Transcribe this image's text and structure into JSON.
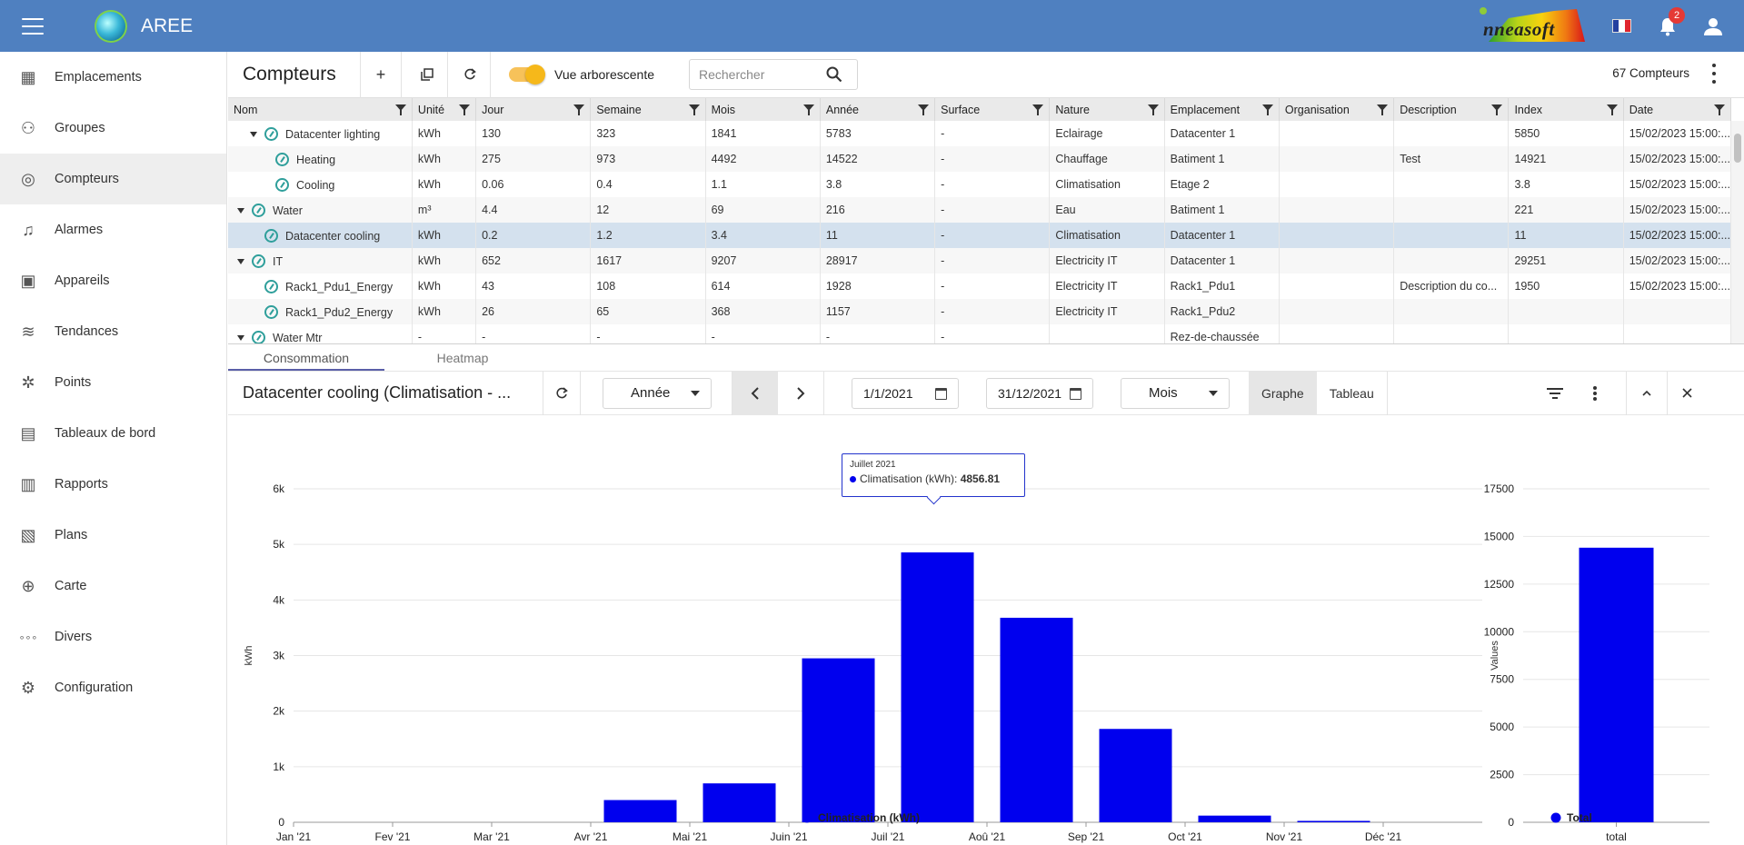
{
  "app": {
    "title": "AREE",
    "brand": "nneasoft",
    "notifications": "2"
  },
  "sidebar": {
    "items": [
      {
        "label": "Emplacements",
        "icon": "building-icon"
      },
      {
        "label": "Groupes",
        "icon": "groups-icon"
      },
      {
        "label": "Compteurs",
        "icon": "meter-icon",
        "active": true
      },
      {
        "label": "Alarmes",
        "icon": "alarm-icon"
      },
      {
        "label": "Appareils",
        "icon": "devices-icon"
      },
      {
        "label": "Tendances",
        "icon": "trends-icon"
      },
      {
        "label": "Points",
        "icon": "points-icon"
      },
      {
        "label": "Tableaux de bord",
        "icon": "dashboard-icon"
      },
      {
        "label": "Rapports",
        "icon": "reports-icon"
      },
      {
        "label": "Plans",
        "icon": "plans-icon"
      },
      {
        "label": "Carte",
        "icon": "map-icon"
      },
      {
        "label": "Divers",
        "icon": "misc-icon"
      },
      {
        "label": "Configuration",
        "icon": "config-icon"
      }
    ]
  },
  "toolbar": {
    "title": "Compteurs",
    "add": "+",
    "toggle_label": "Vue arborescente",
    "search_placeholder": "Rechercher",
    "count": "67 Compteurs"
  },
  "table": {
    "columns": [
      "Nom",
      "Unité",
      "Jour",
      "Semaine",
      "Mois",
      "Année",
      "Surface",
      "Nature",
      "Emplacement",
      "Organisation",
      "Description",
      "Index",
      "Date"
    ],
    "rows": [
      {
        "name": "Datacenter lighting",
        "level": 1,
        "expand": true,
        "unit": "kWh",
        "jour": "130",
        "semaine": "323",
        "mois": "1841",
        "annee": "5783",
        "surface": "-",
        "nature": "Eclairage",
        "emplacement": "Datacenter 1",
        "organisation": "",
        "description": "",
        "index": "5850",
        "date": "15/02/2023 15:00:..."
      },
      {
        "name": "Heating",
        "level": 2,
        "expand": false,
        "unit": "kWh",
        "jour": "275",
        "semaine": "973",
        "mois": "4492",
        "annee": "14522",
        "surface": "-",
        "nature": "Chauffage",
        "emplacement": "Batiment 1",
        "organisation": "",
        "description": "Test",
        "index": "14921",
        "date": "15/02/2023 15:00:..."
      },
      {
        "name": "Cooling",
        "level": 2,
        "expand": false,
        "unit": "kWh",
        "jour": "0.06",
        "semaine": "0.4",
        "mois": "1.1",
        "annee": "3.8",
        "surface": "-",
        "nature": "Climatisation",
        "emplacement": "Etage 2",
        "organisation": "",
        "description": "",
        "index": "3.8",
        "date": "15/02/2023 15:00:..."
      },
      {
        "name": "Water",
        "level": 0,
        "expand": true,
        "unit": "m³",
        "jour": "4.4",
        "semaine": "12",
        "mois": "69",
        "annee": "216",
        "surface": "-",
        "nature": "Eau",
        "emplacement": "Batiment 1",
        "organisation": "",
        "description": "",
        "index": "221",
        "date": "15/02/2023 15:00:..."
      },
      {
        "name": "Datacenter cooling",
        "level": 1,
        "expand": false,
        "selected": true,
        "unit": "kWh",
        "jour": "0.2",
        "semaine": "1.2",
        "mois": "3.4",
        "annee": "11",
        "surface": "-",
        "nature": "Climatisation",
        "emplacement": "Datacenter 1",
        "organisation": "",
        "description": "",
        "index": "11",
        "date": "15/02/2023 15:00:..."
      },
      {
        "name": "IT",
        "level": 0,
        "expand": true,
        "unit": "kWh",
        "jour": "652",
        "semaine": "1617",
        "mois": "9207",
        "annee": "28917",
        "surface": "-",
        "nature": "Electricity IT",
        "emplacement": "Datacenter 1",
        "organisation": "",
        "description": "",
        "index": "29251",
        "date": "15/02/2023 15:00:..."
      },
      {
        "name": "Rack1_Pdu1_Energy",
        "level": 1,
        "expand": false,
        "unit": "kWh",
        "jour": "43",
        "semaine": "108",
        "mois": "614",
        "annee": "1928",
        "surface": "-",
        "nature": "Electricity IT",
        "emplacement": "Rack1_Pdu1",
        "organisation": "",
        "description": "Description du co...",
        "index": "1950",
        "date": "15/02/2023 15:00:..."
      },
      {
        "name": "Rack1_Pdu2_Energy",
        "level": 1,
        "expand": false,
        "unit": "kWh",
        "jour": "26",
        "semaine": "65",
        "mois": "368",
        "annee": "1157",
        "surface": "-",
        "nature": "Electricity IT",
        "emplacement": "Rack1_Pdu2",
        "organisation": "",
        "description": "",
        "index": "",
        "date": ""
      },
      {
        "name": "Water Mtr",
        "level": 0,
        "expand": true,
        "unit": "-",
        "jour": "-",
        "semaine": "-",
        "mois": "-",
        "annee": "-",
        "surface": "-",
        "nature": "",
        "emplacement": "Rez-de-chaussée",
        "organisation": "",
        "description": "",
        "index": "",
        "date": ""
      }
    ]
  },
  "tabs": [
    "Consommation",
    "Heatmap"
  ],
  "chartbar": {
    "title": "Datacenter cooling (Climatisation - ...",
    "period": "Année",
    "start": "1/1/2021",
    "end": "31/12/2021",
    "granularity": "Mois",
    "view_graph": "Graphe",
    "view_table": "Tableau"
  },
  "tooltip": {
    "month": "Juillet 2021",
    "label": "Climatisation (kWh): ",
    "value": "4856.81"
  },
  "chart_data": [
    {
      "type": "bar",
      "categories": [
        "Jan '21",
        "Fev '21",
        "Mar '21",
        "Avr '21",
        "Mai '21",
        "Juin '21",
        "Juil '21",
        "Aoû '21",
        "Sep '21",
        "Oct '21",
        "Nov '21",
        "Déc '21"
      ],
      "series": [
        {
          "name": "Climatisation (kWh)",
          "values": [
            0,
            0,
            0,
            400,
            700,
            2950,
            4856.81,
            3680,
            1680,
            120,
            25,
            0
          ]
        }
      ],
      "ylabel": "kWh",
      "yticks": [
        "0",
        "1k",
        "2k",
        "3k",
        "4k",
        "5k",
        "6k"
      ],
      "ylim": [
        0,
        6000
      ],
      "color": "#0000ee",
      "grid": true,
      "legend": "bottom"
    },
    {
      "type": "bar",
      "categories": [
        "total"
      ],
      "series": [
        {
          "name": "Total",
          "values": [
            14410
          ]
        }
      ],
      "ylabel": "Values",
      "yticks": [
        "0",
        "2500",
        "5000",
        "7500",
        "10000",
        "12500",
        "15000",
        "17500"
      ],
      "ylim": [
        0,
        17500
      ],
      "color": "#0000ee",
      "grid": true,
      "legend": "bottom"
    }
  ]
}
